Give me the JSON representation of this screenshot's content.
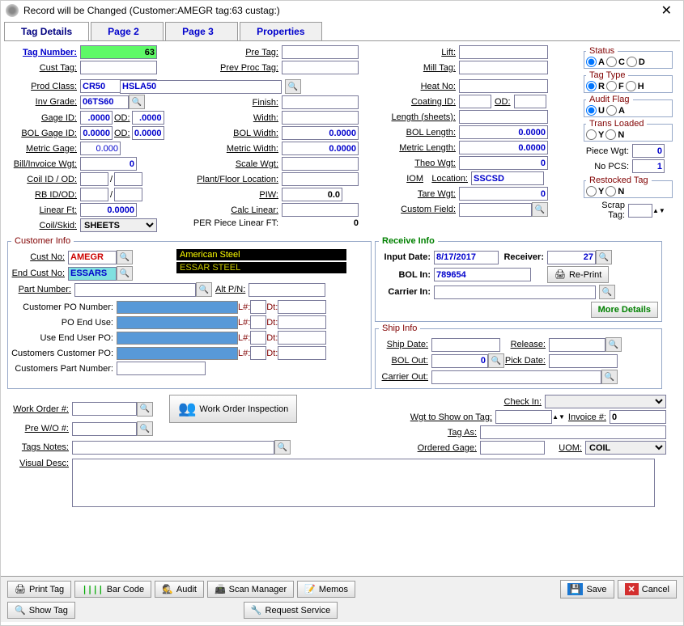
{
  "window": {
    "title": "Record will be Changed  (Customer:AMEGR  tag:63 custag:)"
  },
  "tabs": [
    "Tag Details",
    "Page 2",
    "Page 3",
    "Properties"
  ],
  "left": {
    "tagNumber": {
      "label": "Tag Number:",
      "value": "63"
    },
    "custTag": {
      "label": "Cust Tag:",
      "value": ""
    },
    "prodClass": {
      "label": "Prod Class:",
      "value": "CR50",
      "value2": "HSLA50"
    },
    "invGrade": {
      "label": "Inv Grade:",
      "value": "06TS60"
    },
    "gageId": {
      "label": "Gage ID:",
      "value": ".0000",
      "od": ".0000",
      "odLbl": "OD:"
    },
    "bolGageId": {
      "label": "BOL Gage ID:",
      "value": "0.0000",
      "od": "0.0000",
      "odLbl": "OD:"
    },
    "metricGage": {
      "label": "Metric Gage:",
      "value": "0.000"
    },
    "billWgt": {
      "label": "Bill/Invoice Wgt:",
      "value": "0"
    },
    "coilIdOd": {
      "label": "Coil ID / OD:",
      "v1": "",
      "sep": "/",
      "v2": ""
    },
    "rbIdOd": {
      "label": "RB ID/OD:",
      "v1": "",
      "sep": "/",
      "v2": ""
    },
    "linearFt": {
      "label": "Linear Ft:",
      "value": "0.0000"
    },
    "coilSkid": {
      "label": "Coil/Skid:",
      "value": "SHEETS"
    }
  },
  "mid": {
    "preTag": {
      "label": "Pre Tag:",
      "value": ""
    },
    "prevProcTag": {
      "label": "Prev Proc Tag:",
      "value": ""
    },
    "finish": {
      "label": "Finish:",
      "value": ""
    },
    "width": {
      "label": "Width:",
      "value": ""
    },
    "bolWidth": {
      "label": "BOL Width:",
      "value": "0.0000"
    },
    "metricWidth": {
      "label": "Metric Width:",
      "value": "0.0000"
    },
    "scaleWgt": {
      "label": "Scale Wgt:",
      "value": ""
    },
    "plantFloor": {
      "label": "Plant/Floor Location:",
      "value": ""
    },
    "piw": {
      "label": "PIW:",
      "value": "0.0"
    },
    "calcLinear": {
      "label": "Calc Linear:",
      "value": ""
    },
    "perPiece": {
      "label": "PER Piece Linear FT:",
      "value": "0"
    }
  },
  "right": {
    "lift": {
      "label": "Lift:",
      "value": ""
    },
    "millTag": {
      "label": "Mill Tag:",
      "value": ""
    },
    "heatNo": {
      "label": "Heat No:",
      "value": ""
    },
    "coatingId": {
      "label": "Coating ID:",
      "value": "",
      "od": "",
      "odLbl": "OD:"
    },
    "lengthSheets": {
      "label": "Length (sheets):",
      "value": ""
    },
    "bolLength": {
      "label": "BOL Length:",
      "value": "0.0000"
    },
    "metricLength": {
      "label": "Metric Length:",
      "value": "0.0000"
    },
    "theoWgt": {
      "label": "Theo Wgt:",
      "value": "0"
    },
    "iom": {
      "label": "IOM",
      "locLbl": "Location:",
      "loc": "SSCSD"
    },
    "tareWgt": {
      "label": "Tare Wgt:",
      "value": "0"
    },
    "customField": {
      "label": "Custom Field:",
      "value": ""
    }
  },
  "radios": {
    "status": {
      "legend": "Status",
      "opts": [
        "A",
        "C",
        "D"
      ]
    },
    "tagType": {
      "legend": "Tag Type",
      "opts": [
        "R",
        "F",
        "H"
      ]
    },
    "auditFlag": {
      "legend": "Audit Flag",
      "opts": [
        "U",
        "A"
      ]
    },
    "transLoaded": {
      "legend": "Trans Loaded",
      "opts": [
        "Y",
        "N"
      ]
    },
    "restocked": {
      "legend": "Restocked Tag",
      "opts": [
        "Y",
        "N"
      ]
    }
  },
  "sidebar": {
    "pieceWgt": {
      "label": "Piece Wgt:",
      "value": "0"
    },
    "noPcs": {
      "label": "No PCS:",
      "value": "1"
    },
    "scrapTag": {
      "label": "Scrap Tag:",
      "value": ""
    }
  },
  "customer": {
    "legend": "Customer Info",
    "custNo": {
      "label": "Cust No:",
      "value": "AMEGR",
      "name": "American Steel"
    },
    "endCustNo": {
      "label": "End Cust No:",
      "value": "ESSARS",
      "name": "ESSAR STEEL"
    },
    "partNumber": {
      "label": "Part Number:",
      "value": "",
      "altLbl": "Alt P/N:",
      "alt": ""
    },
    "custPO": {
      "label": "Customer PO Number:",
      "l": "L#:",
      "d": "Dt:"
    },
    "poEndUse": {
      "label": "PO End Use:",
      "l": "L#:",
      "d": "Dt:"
    },
    "useEndUserPO": {
      "label": "Use End User PO:",
      "l": "L#:",
      "d": "Dt:"
    },
    "custCustomerPO": {
      "label": "Customers Customer PO:",
      "l": "L#:",
      "d": "Dt:"
    },
    "custPartNumber": {
      "label": "Customers Part Number:",
      "value": ""
    }
  },
  "receive": {
    "legend": "Receive Info",
    "inputDate": {
      "label": "Input Date:",
      "value": "8/17/2017"
    },
    "receiver": {
      "label": "Receiver:",
      "value": "27"
    },
    "bolIn": {
      "label": "BOL In:",
      "value": "789654"
    },
    "reprint": "Re-Print",
    "carrierIn": {
      "label": "Carrier In:",
      "value": ""
    },
    "moreDetails": "More Details"
  },
  "ship": {
    "legend": "Ship Info",
    "shipDate": {
      "label": "Ship Date:",
      "value": ""
    },
    "release": {
      "label": "Release:",
      "value": ""
    },
    "bolOut": {
      "label": "BOL Out:",
      "value": "0"
    },
    "pickDate": {
      "label": "Pick Date:",
      "value": ""
    },
    "carrierOut": {
      "label": "Carrier Out:",
      "value": ""
    }
  },
  "lower": {
    "checkIn": {
      "label": "Check In:",
      "value": ""
    },
    "wgtToShow": {
      "label": "Wgt to Show on Tag:",
      "value": ""
    },
    "invoiceNo": {
      "label": "Invoice #:",
      "value": "0"
    },
    "tagAs": {
      "label": "Tag As:",
      "value": ""
    },
    "orderedGage": {
      "label": "Ordered Gage:",
      "value": ""
    },
    "uom": {
      "label": "UOM:",
      "value": "COIL"
    }
  },
  "workOrder": {
    "woNo": {
      "label": "Work Order #:",
      "value": ""
    },
    "preWO": {
      "label": "Pre W/O #:",
      "value": ""
    },
    "inspection": "Work Order Inspection",
    "tagsNotes": {
      "label": "Tags Notes:",
      "value": ""
    },
    "visualDesc": {
      "label": "Visual Desc:",
      "value": ""
    }
  },
  "buttons": {
    "printTag": "Print Tag",
    "barCode": "Bar Code",
    "audit": "Audit",
    "scanManager": "Scan Manager",
    "memos": "Memos",
    "showTag": "Show Tag",
    "requestService": "Request Service",
    "save": "Save",
    "cancel": "Cancel"
  }
}
